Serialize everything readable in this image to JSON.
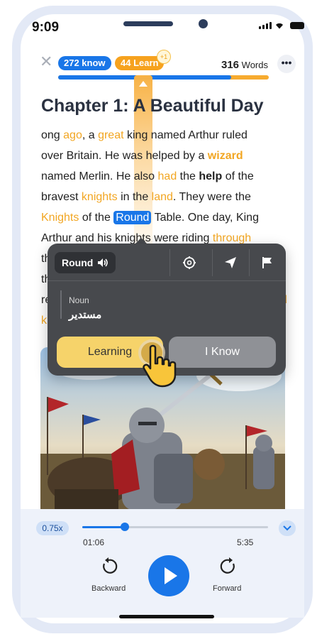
{
  "status": {
    "time": "9:09"
  },
  "header": {
    "know_label": "272 know",
    "learn_label": "44 Learn",
    "plus_badge": "+1",
    "word_count": "316",
    "word_unit": "Words",
    "progress_fraction": 0.82,
    "colors": {
      "know": "#1976e8",
      "learn": "#f6a21e"
    }
  },
  "chapter": {
    "title": "Chapter 1: A Beautiful Day"
  },
  "story": {
    "l1": {
      "a": "ong ",
      "b": "ago",
      "c": ", a ",
      "d": "great",
      "e": " king named Arthur ruled"
    },
    "l2": {
      "a": "over Britain. He was helped by a ",
      "b": "wizard"
    },
    "l3": {
      "a": "named Merlin. He also ",
      "b": "had",
      "c": " the ",
      "d": "help",
      "e": " of the"
    },
    "l4": {
      "a": "bravest ",
      "b": "knights",
      "c": " in the ",
      "d": "land",
      "e": ". They were the"
    },
    "l5": {
      "a": "Knights",
      "b": " of the ",
      "c": "Round",
      "d": " Table. One day, King"
    },
    "l6": {
      "a": "Arthur and his knights were riding ",
      "b": "through"
    },
    "partials": {
      "l7": "th",
      "l8": "th",
      "l9a": "re",
      "l9b": "d",
      "l10a": "k",
      "l10b": "."
    }
  },
  "popup": {
    "word": "Round",
    "part_of_speech": "Noun",
    "translation": "مستدير",
    "learning_button": "Learning",
    "know_button": "I Know",
    "icons": [
      "speaker-icon",
      "settings-icon",
      "share-icon",
      "flag-icon"
    ]
  },
  "player": {
    "speed": "0.75x",
    "current_time": "01:06",
    "total_time": "5:35",
    "progress_fraction": 0.23,
    "backward_label": "Backward",
    "forward_label": "Forward"
  }
}
